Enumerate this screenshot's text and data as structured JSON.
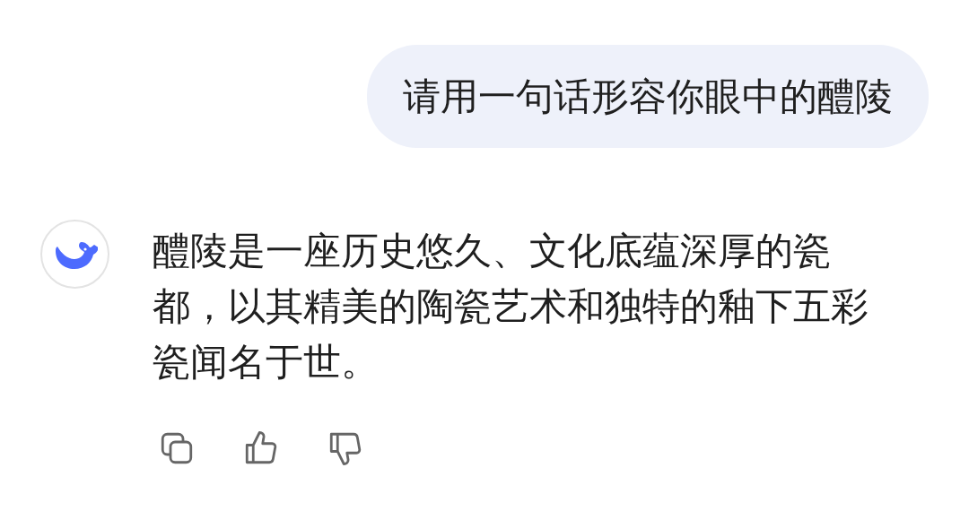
{
  "user_message": {
    "text": "请用一句话形容你眼中的醴陵"
  },
  "assistant_message": {
    "text": "醴陵是一座历史悠久、文化底蕴深厚的瓷都，以其精美的陶瓷艺术和独特的釉下五彩瓷闻名于世。"
  }
}
